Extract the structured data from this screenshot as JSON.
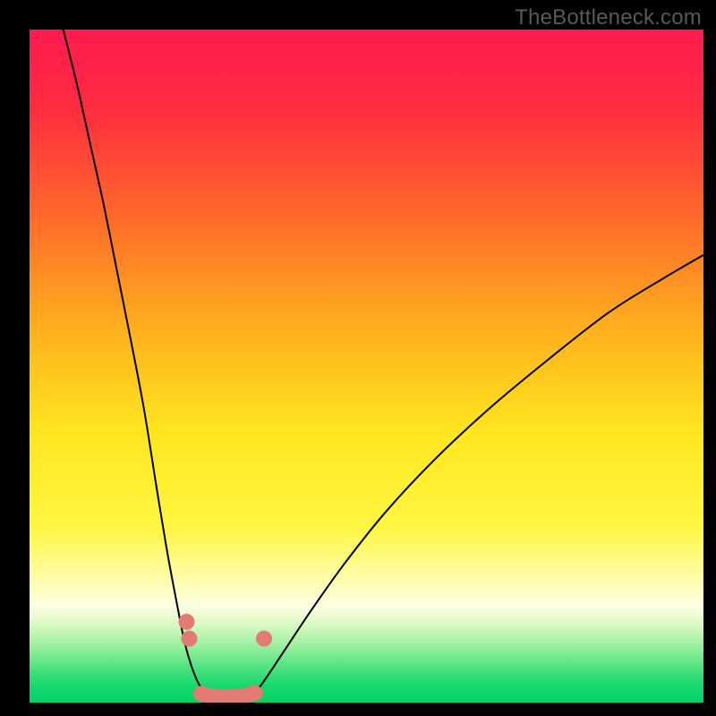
{
  "watermark": "TheBottleneck.com",
  "chart_data": {
    "type": "line",
    "title": "",
    "xlabel": "",
    "ylabel": "",
    "xlim": [
      0,
      100
    ],
    "ylim": [
      0,
      100
    ],
    "gradient_stops": [
      {
        "offset": 0.0,
        "color": "#ff1a4f"
      },
      {
        "offset": 0.12,
        "color": "#ff2d3f"
      },
      {
        "offset": 0.28,
        "color": "#ff6a2a"
      },
      {
        "offset": 0.45,
        "color": "#ffb21e"
      },
      {
        "offset": 0.6,
        "color": "#ffe61f"
      },
      {
        "offset": 0.74,
        "color": "#fff642"
      },
      {
        "offset": 0.82,
        "color": "#fffdb0"
      },
      {
        "offset": 0.855,
        "color": "#fdfee0"
      },
      {
        "offset": 0.875,
        "color": "#e7fbce"
      },
      {
        "offset": 0.895,
        "color": "#c4f6b6"
      },
      {
        "offset": 0.915,
        "color": "#9df0a0"
      },
      {
        "offset": 0.935,
        "color": "#6de88b"
      },
      {
        "offset": 0.955,
        "color": "#3fdf7a"
      },
      {
        "offset": 0.975,
        "color": "#17d86e"
      },
      {
        "offset": 1.0,
        "color": "#00d267"
      }
    ],
    "series": [
      {
        "name": "left-curve",
        "type": "line",
        "color": "#000000",
        "stroke_width": 2,
        "x": [
          5.0,
          7.0,
          9.0,
          11.0,
          13.0,
          15.0,
          17.0,
          19.0,
          20.5,
          22.0,
          23.0,
          24.0,
          25.0,
          26.0,
          27.0
        ],
        "y": [
          100.0,
          92.0,
          83.0,
          74.0,
          64.0,
          54.0,
          43.5,
          31.0,
          22.0,
          14.0,
          9.0,
          5.5,
          3.0,
          1.5,
          0.8
        ]
      },
      {
        "name": "right-curve",
        "type": "line",
        "color": "#000000",
        "stroke_width": 2,
        "x": [
          33.0,
          35.0,
          38.0,
          42.0,
          47.0,
          53.0,
          60.0,
          68.0,
          77.0,
          86.0,
          94.0,
          100.0
        ],
        "y": [
          0.8,
          3.5,
          8.0,
          14.0,
          21.0,
          28.5,
          36.0,
          43.5,
          51.0,
          58.0,
          63.0,
          66.5
        ]
      },
      {
        "name": "markers",
        "type": "scatter",
        "color": "#e17b74",
        "radius": 9,
        "x": [
          23.3,
          23.7,
          25.5,
          27.0,
          29.5,
          32.0,
          33.3,
          34.8
        ],
        "y": [
          12.0,
          9.5,
          1.3,
          0.9,
          0.8,
          1.0,
          1.4,
          9.5
        ]
      },
      {
        "name": "valley-band",
        "type": "line",
        "color": "#e17b74",
        "stroke_width": 17,
        "x": [
          25.5,
          27.0,
          29.5,
          32.0,
          33.5
        ],
        "y": [
          1.3,
          0.9,
          0.8,
          1.0,
          1.4
        ]
      }
    ]
  }
}
